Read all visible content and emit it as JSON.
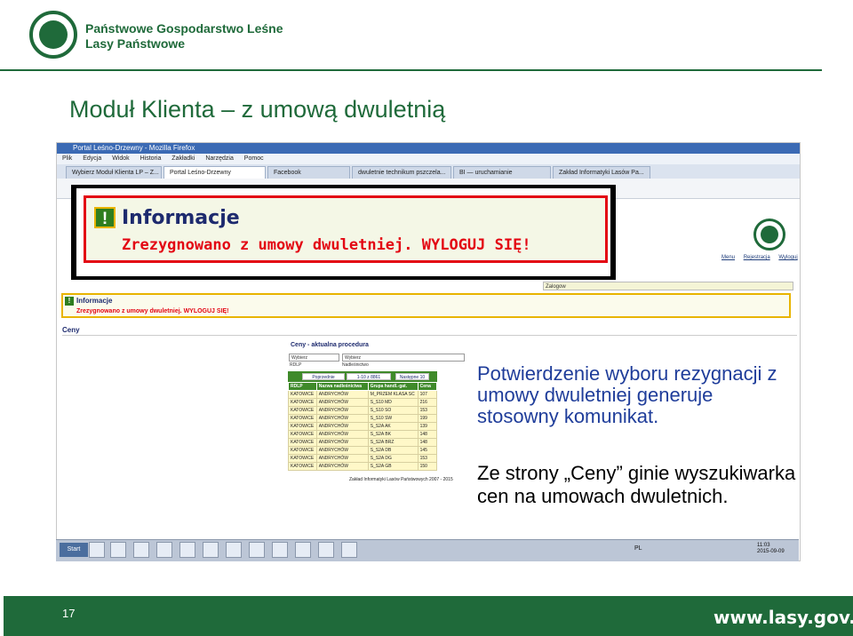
{
  "header": {
    "org_line1": "Państwowe Gospodarstwo Leśne",
    "org_line2": "Lasy Państwowe"
  },
  "slide_title": "Moduł Klienta – z umową dwuletnią",
  "browser": {
    "window_title": "Portal Leśno-Drzewny - Mozilla Firefox",
    "menu": [
      "Plik",
      "Edycja",
      "Widok",
      "Historia",
      "Zakładki",
      "Narzędzia",
      "Pomoc"
    ],
    "tabs": [
      "Wybierz Moduł Klienta LP – Z...",
      "Portal Leśno-Drzewny",
      "Facebook",
      "dwuletnie technikum pszczela...",
      "BI — uruchamianie",
      "Zakład Informatyki Lasów Pa..."
    ]
  },
  "dialog": {
    "title": "Informacje",
    "message": "Zrezygnowano z umowy dwuletniej. WYLOGUJ SIĘ!"
  },
  "portal": {
    "top_links": [
      "Menu",
      "Rejestracja",
      "Wyloguj"
    ],
    "login_text": "Zalogow",
    "info_title": "Informacje",
    "info_message": "Zrezygnowano z umowy dwuletniej. WYLOGUJ SIĘ!",
    "section": "Ceny",
    "procedure_title": "Ceny - aktualna procedura",
    "select1": "Wybierz",
    "select2": "Wybierz",
    "label_rdlp": "RDLP",
    "label_nadl": "Nadleśnictwo",
    "pager": {
      "prev": "Poprzednie",
      "range": "1-10 z 8861",
      "next": "Następne 10"
    },
    "table": {
      "headers": [
        "RDLP",
        "Nazwa nadleśnictwa",
        "Grupa handl.-gat.",
        "Cena"
      ],
      "rows": [
        [
          "KATOWICE",
          "ANDRYCHÓW",
          "M_PRZEM KLASA SC",
          "107"
        ],
        [
          "KATOWICE",
          "ANDRYCHÓW",
          "S_S10 MD",
          "216"
        ],
        [
          "KATOWICE",
          "ANDRYCHÓW",
          "S_S10 SO",
          "153"
        ],
        [
          "KATOWICE",
          "ANDRYCHÓW",
          "S_S10 SW",
          "199"
        ],
        [
          "KATOWICE",
          "ANDRYCHÓW",
          "S_S2A AK",
          "139"
        ],
        [
          "KATOWICE",
          "ANDRYCHÓW",
          "S_S2A BK",
          "148"
        ],
        [
          "KATOWICE",
          "ANDRYCHÓW",
          "S_S2A BRZ",
          "148"
        ],
        [
          "KATOWICE",
          "ANDRYCHÓW",
          "S_S2A DB",
          "145"
        ],
        [
          "KATOWICE",
          "ANDRYCHÓW",
          "S_S2A DG",
          "153"
        ],
        [
          "KATOWICE",
          "ANDRYCHÓW",
          "S_S2A GB",
          "150"
        ]
      ]
    },
    "footer": "Zakład Informatyki Lasów Państwowych 2007 - 2015"
  },
  "annotations": {
    "text1": "Potwierdzenie wyboru rezygnacji z umowy dwuletniej generuje stosowny komunikat.",
    "text2": "Ze strony „Ceny” ginie wyszukiwarka cen na umowach dwuletnich."
  },
  "taskbar": {
    "start": "Start",
    "lang": "PL",
    "time": "11:03",
    "date": "2015-09-09"
  },
  "footer": {
    "page_number": "17",
    "site": "www.lasy.gov.pl"
  },
  "colors": {
    "brand_green": "#1f6a3a",
    "alert_red": "#e30613",
    "annotation_blue": "#1f3d9a"
  }
}
